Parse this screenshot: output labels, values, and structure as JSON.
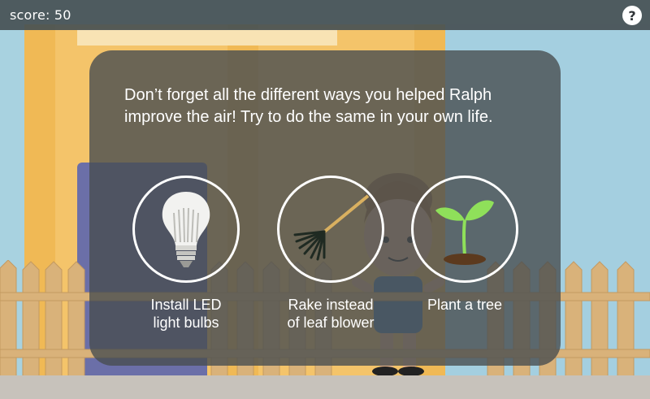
{
  "topbar": {
    "score_label": "score: 50",
    "help_icon": "question-mark-icon",
    "help_label": "?"
  },
  "panel": {
    "message_line1": "Don’t forget all the different ways you helped Ralph",
    "message_line2": "improve the air! Try to do the same in your own life.",
    "tips": [
      {
        "icon": "led-bulb-icon",
        "label_line1": "Install LED",
        "label_line2": "light bulbs"
      },
      {
        "icon": "rake-icon",
        "label_line1": "Rake instead",
        "label_line2": "of leaf blower"
      },
      {
        "icon": "seedling-icon",
        "label_line1": "Plant a tree",
        "label_line2": ""
      }
    ]
  },
  "colors": {
    "topbar_bg": "#464f52",
    "panel_bg": "#484e50",
    "house": "#f4c46a",
    "sky": "#a8d2e0",
    "door": "#6b6fa8",
    "sprout_green": "#8fe05a"
  }
}
